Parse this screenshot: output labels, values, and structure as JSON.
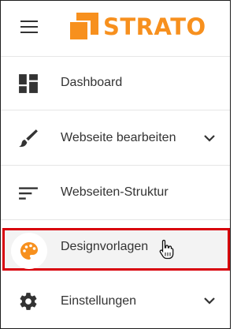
{
  "brand": {
    "name": "STRATO",
    "color": "#f7901e"
  },
  "menu": {
    "icon": "hamburger-menu-icon"
  },
  "nav": {
    "items": [
      {
        "label": "Dashboard",
        "icon": "dashboard-icon",
        "has_submenu": false,
        "active": false
      },
      {
        "label": "Webseite bearbeiten",
        "icon": "brush-icon",
        "has_submenu": true,
        "active": false
      },
      {
        "label": "Webseiten-Struktur",
        "icon": "structure-icon",
        "has_submenu": false,
        "active": false
      },
      {
        "label": "Designvorlagen",
        "icon": "palette-icon",
        "has_submenu": false,
        "active": true
      },
      {
        "label": "Einstellungen",
        "icon": "gear-icon",
        "has_submenu": true,
        "active": false
      }
    ]
  },
  "colors": {
    "highlight_border": "#d8000a",
    "text": "#333333",
    "icon": "#333333"
  }
}
